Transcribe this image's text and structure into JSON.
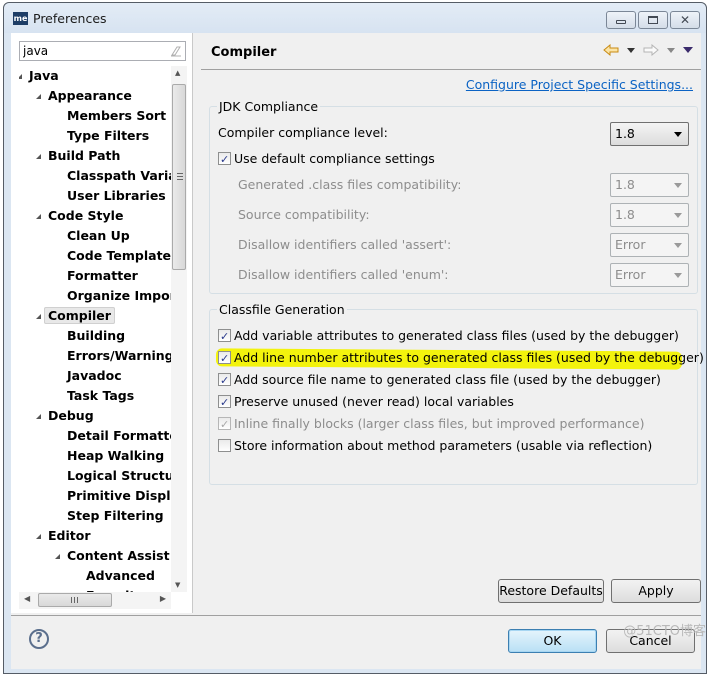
{
  "window": {
    "title": "Preferences",
    "app_icon_text": "me",
    "controls": [
      "minimize",
      "maximize",
      "close"
    ]
  },
  "filter": {
    "value": "java",
    "placeholder": ""
  },
  "tree": {
    "items": [
      {
        "label": "Java",
        "level": 0,
        "expanded": true
      },
      {
        "label": "Appearance",
        "level": 1,
        "expanded": true
      },
      {
        "label": "Members Sort Order",
        "level": 2
      },
      {
        "label": "Type Filters",
        "level": 2
      },
      {
        "label": "Build Path",
        "level": 1,
        "expanded": true
      },
      {
        "label": "Classpath Variables",
        "level": 2
      },
      {
        "label": "User Libraries",
        "level": 2
      },
      {
        "label": "Code Style",
        "level": 1,
        "expanded": true
      },
      {
        "label": "Clean Up",
        "level": 2
      },
      {
        "label": "Code Templates",
        "level": 2
      },
      {
        "label": "Formatter",
        "level": 2
      },
      {
        "label": "Organize Imports",
        "level": 2
      },
      {
        "label": "Compiler",
        "level": 1,
        "expanded": true,
        "selected": true
      },
      {
        "label": "Building",
        "level": 2
      },
      {
        "label": "Errors/Warnings",
        "level": 2
      },
      {
        "label": "Javadoc",
        "level": 2
      },
      {
        "label": "Task Tags",
        "level": 2
      },
      {
        "label": "Debug",
        "level": 1,
        "expanded": true
      },
      {
        "label": "Detail Formatters",
        "level": 2
      },
      {
        "label": "Heap Walking",
        "level": 2
      },
      {
        "label": "Logical Structures",
        "level": 2
      },
      {
        "label": "Primitive Display Options",
        "level": 2
      },
      {
        "label": "Step Filtering",
        "level": 2
      },
      {
        "label": "Editor",
        "level": 1,
        "expanded": true
      },
      {
        "label": "Content Assist",
        "level": 2,
        "expanded": true
      },
      {
        "label": "Advanced",
        "level": 3
      },
      {
        "label": "Favorites",
        "level": 3
      }
    ]
  },
  "page": {
    "title": "Compiler",
    "configure_link": "Configure Project Specific Settings...",
    "jdk_group": {
      "title": "JDK Compliance",
      "compliance_label": "Compiler compliance level:",
      "compliance_value": "1.8",
      "use_default_label": "Use default compliance settings",
      "use_default_checked": true,
      "rows": [
        {
          "label": "Generated .class files compatibility:",
          "value": "1.8"
        },
        {
          "label": "Source compatibility:",
          "value": "1.8"
        },
        {
          "label": "Disallow identifiers called 'assert':",
          "value": "Error"
        },
        {
          "label": "Disallow identifiers called 'enum':",
          "value": "Error"
        }
      ]
    },
    "classfile_group": {
      "title": "Classfile Generation",
      "options": [
        {
          "label": "Add variable attributes to generated class files (used by the debugger)",
          "checked": true,
          "enabled": true
        },
        {
          "label": "Add line number attributes to generated class files (used by the debugger)",
          "checked": true,
          "enabled": true,
          "highlighted": true
        },
        {
          "label": "Add source file name to generated class file (used by the debugger)",
          "checked": true,
          "enabled": true
        },
        {
          "label": "Preserve unused (never read) local variables",
          "checked": true,
          "enabled": true
        },
        {
          "label": "Inline finally blocks (larger class files, but improved performance)",
          "checked": true,
          "enabled": false
        },
        {
          "label": "Store information about method parameters (usable via reflection)",
          "checked": false,
          "enabled": true
        }
      ]
    },
    "restore_defaults": "Restore Defaults",
    "apply": "Apply"
  },
  "footer": {
    "help": "?",
    "ok": "OK",
    "cancel": "Cancel",
    "watermark": "@51CTO博客"
  },
  "colors": {
    "link": "#0b63c4",
    "highlight": "#f2f200",
    "default_button": "#b9e0f5"
  }
}
